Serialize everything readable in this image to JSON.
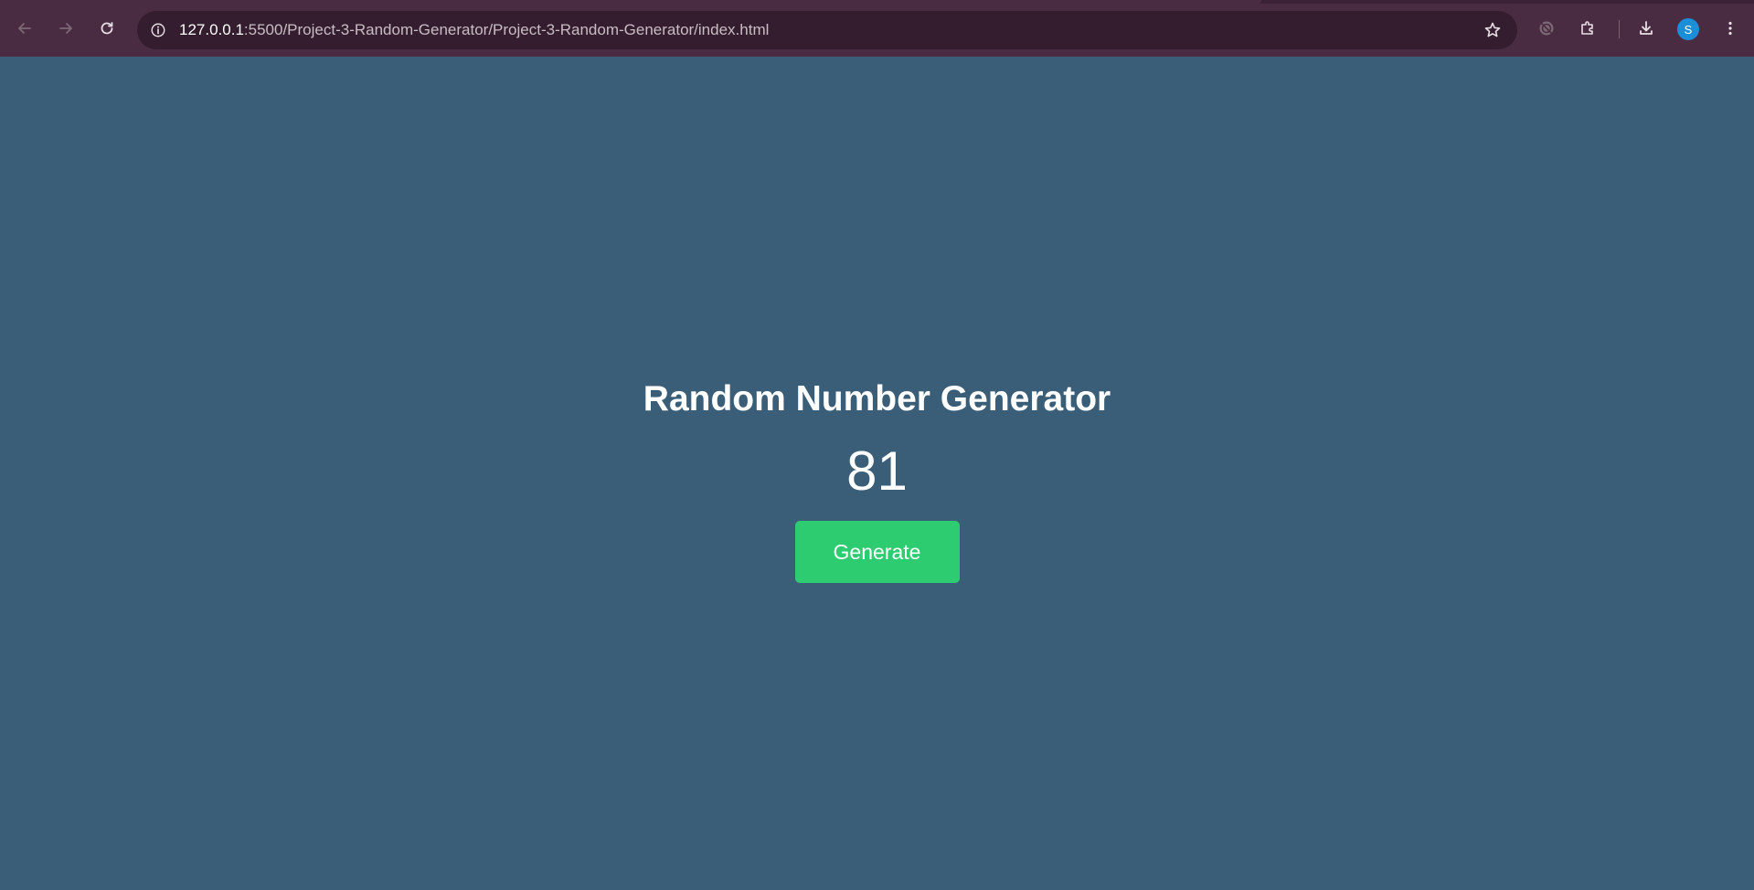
{
  "browser": {
    "url_host": "127.0.0.1",
    "url_path": ":5500/Project-3-Random-Generator/Project-3-Random-Generator/index.html",
    "profile_initial": "S",
    "colors": {
      "toolbar": "#4a2c42",
      "omnibox": "#331d2e",
      "avatar": "#1a8fd8"
    },
    "icons": [
      "back-arrow-icon",
      "forward-arrow-icon",
      "reload-icon",
      "site-info-icon",
      "bookmark-star-icon",
      "extension-blocked-icon",
      "extensions-puzzle-icon",
      "downloads-icon",
      "menu-kebab-icon"
    ]
  },
  "page": {
    "title": "Random Number Generator",
    "number": "81",
    "generate_label": "Generate",
    "colors": {
      "background": "#3a5e78",
      "button": "#2ecc71",
      "text": "#ffffff"
    }
  }
}
